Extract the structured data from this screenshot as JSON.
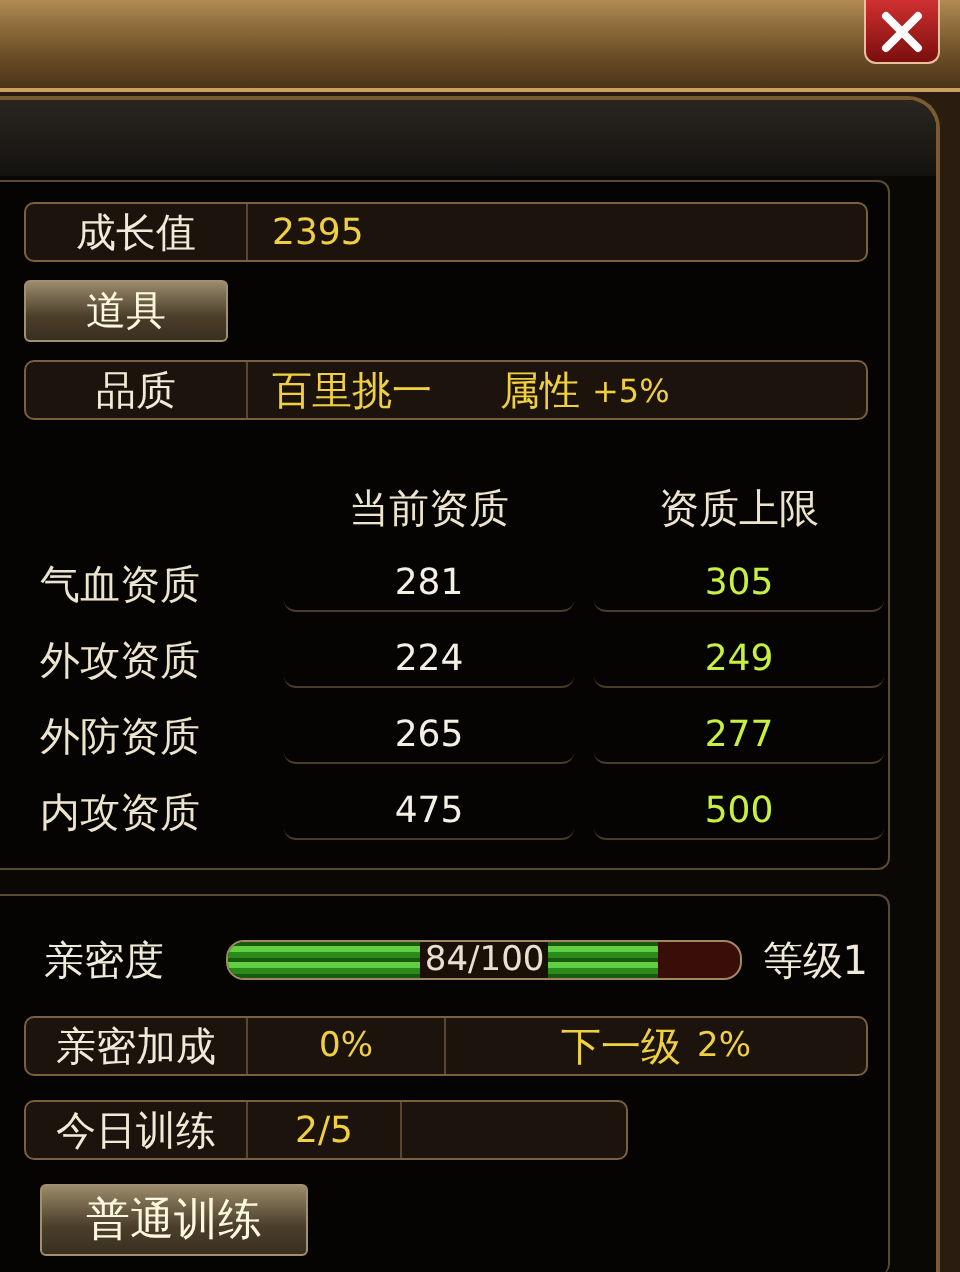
{
  "growth": {
    "label": "成长值",
    "value": "2395"
  },
  "item_button": {
    "label": "道具"
  },
  "quality": {
    "label": "品质",
    "value": "百里挑一",
    "attribute_label": "属性",
    "attribute_value": "+5%"
  },
  "aptitude_table": {
    "columns": [
      "当前资质",
      "资质上限"
    ],
    "rows": [
      {
        "name": "气血资质",
        "current": "281",
        "max": "305"
      },
      {
        "name": "外攻资质",
        "current": "224",
        "max": "249"
      },
      {
        "name": "外防资质",
        "current": "265",
        "max": "277"
      },
      {
        "name": "内攻资质",
        "current": "475",
        "max": "500"
      }
    ]
  },
  "intimacy": {
    "label": "亲密度",
    "level": 0.84,
    "reading": "84/100",
    "grade": "等级1"
  },
  "intimacy_bonus": {
    "label": "亲密加成",
    "value": "0%",
    "next_label": "下一级",
    "next_value": "2%"
  },
  "training": {
    "label": "今日训练",
    "value": "2/5"
  },
  "train_button": {
    "label": "普通训练"
  }
}
